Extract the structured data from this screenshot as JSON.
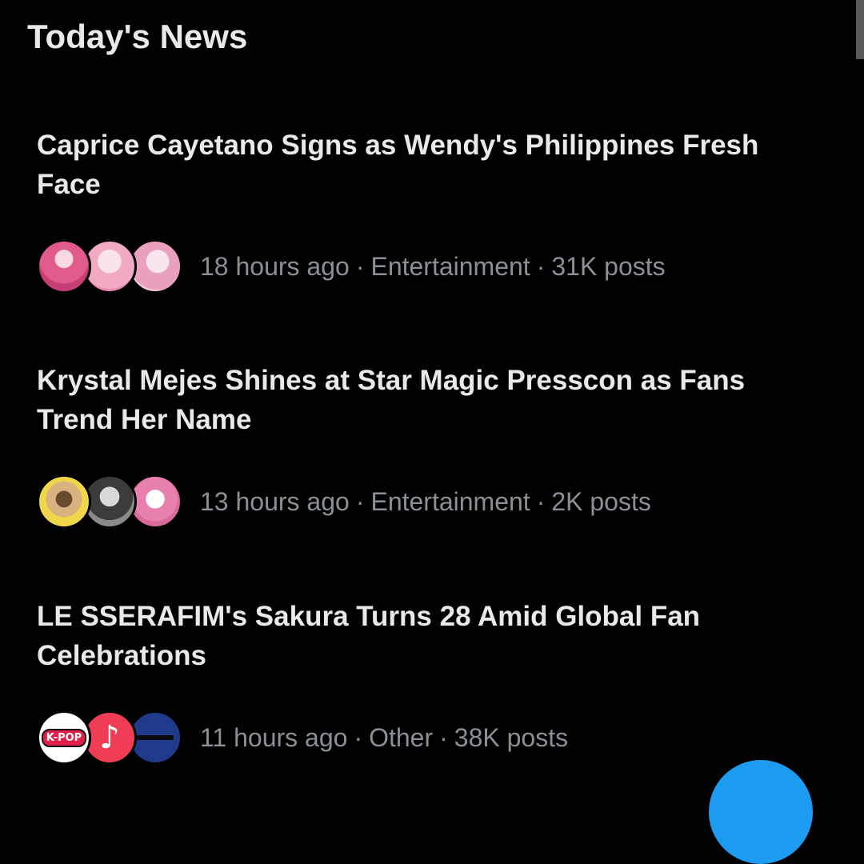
{
  "section": {
    "title": "Today's News"
  },
  "news": [
    {
      "headline": "Caprice Cayetano Signs as Wendy's Philippines Fresh Face",
      "time": "18 hours ago",
      "category": "Entertainment",
      "posts": "31K posts",
      "separator": "·"
    },
    {
      "headline": "Krystal Mejes Shines at Star Magic Presscon as Fans Trend Her Name",
      "time": "13 hours ago",
      "category": "Entertainment",
      "posts": "2K posts",
      "separator": "·"
    },
    {
      "headline": "LE SSERAFIM's Sakura Turns 28 Amid Global Fan Celebrations",
      "time": "11 hours ago",
      "category": "Other",
      "posts": "38K posts",
      "separator": "·"
    }
  ],
  "avatars": {
    "kpop_label": "K-POP",
    "music_glyph": "♪"
  },
  "colors": {
    "background": "#000000",
    "headline": "#e7e9ea",
    "meta": "#8b9096",
    "accent": "#1d9bf0"
  }
}
